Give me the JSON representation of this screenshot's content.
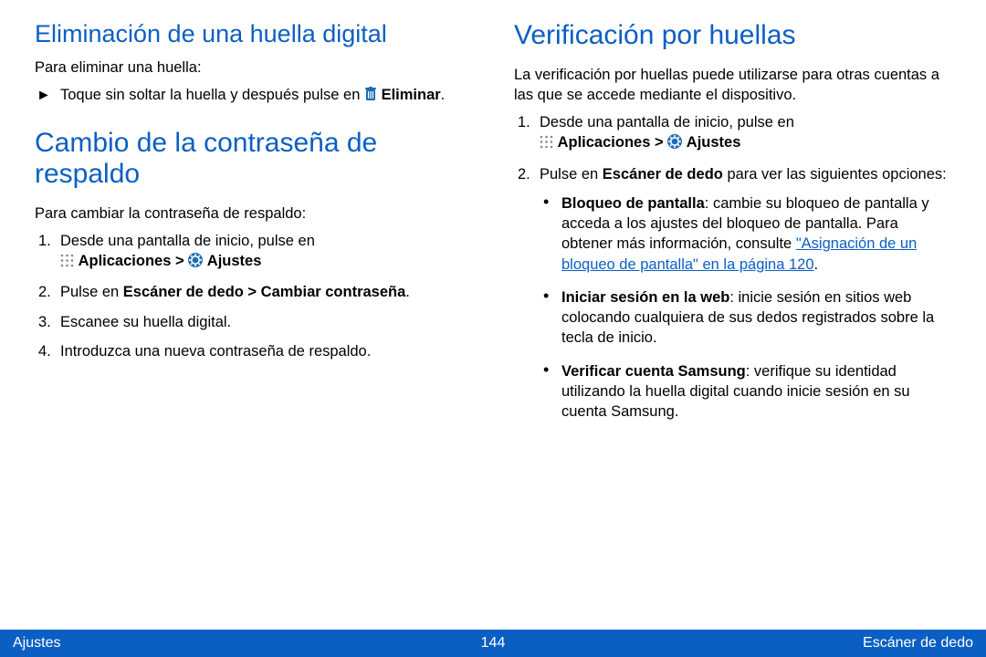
{
  "left": {
    "h_delete": "Eliminación de una huella digital",
    "delete_intro": "Para eliminar una huella:",
    "delete_step_pre": "Toque sin soltar la huella y después pulse en ",
    "delete_step_action": "Eliminar",
    "delete_step_post": ".",
    "h_backup": "Cambio de la contraseña de respaldo",
    "backup_intro": "Para cambiar la contraseña de respaldo:",
    "backup_s1_pre": "Desde una pantalla de inicio, pulse en",
    "apps_label": "Aplicaciones > ",
    "settings_label": "Ajustes",
    "backup_s2_pre": "Pulse en ",
    "backup_s2_bold": "Escáner de dedo > Cambiar contraseña",
    "backup_s2_post": ".",
    "backup_s3": "Escanee su huella digital.",
    "backup_s4": "Introduzca una nueva contraseña de respaldo."
  },
  "right": {
    "h_verify": "Verificación por huellas",
    "verify_intro": "La verificación por huellas puede utilizarse para otras cuentas a las que se accede mediante el dispositivo.",
    "verify_s1_pre": "Desde una pantalla de inicio, pulse en",
    "apps_label": "Aplicaciones > ",
    "settings_label": "Ajustes",
    "verify_s2_pre": "Pulse en ",
    "verify_s2_bold": "Escáner de dedo",
    "verify_s2_post": " para ver las siguientes opciones:",
    "b1_bold": "Bloqueo de pantalla",
    "b1_text": ": cambie su bloqueo de pantalla y acceda a los ajustes del bloqueo de pantalla. Para obtener más información, consulte ",
    "b1_link": "\"Asignación de un bloqueo de pantalla\" en la página 120",
    "b1_post": ".",
    "b2_bold": "Iniciar sesión en la web",
    "b2_text": ": inicie sesión en sitios web colocando cualquiera de sus dedos registrados sobre la tecla de inicio.",
    "b3_bold": "Verificar cuenta Samsung",
    "b3_text": ": verifique su identidad utilizando la huella digital cuando inicie sesión en su cuenta Samsung."
  },
  "footer": {
    "left": "Ajustes",
    "center": "144",
    "right": "Escáner de dedo"
  }
}
